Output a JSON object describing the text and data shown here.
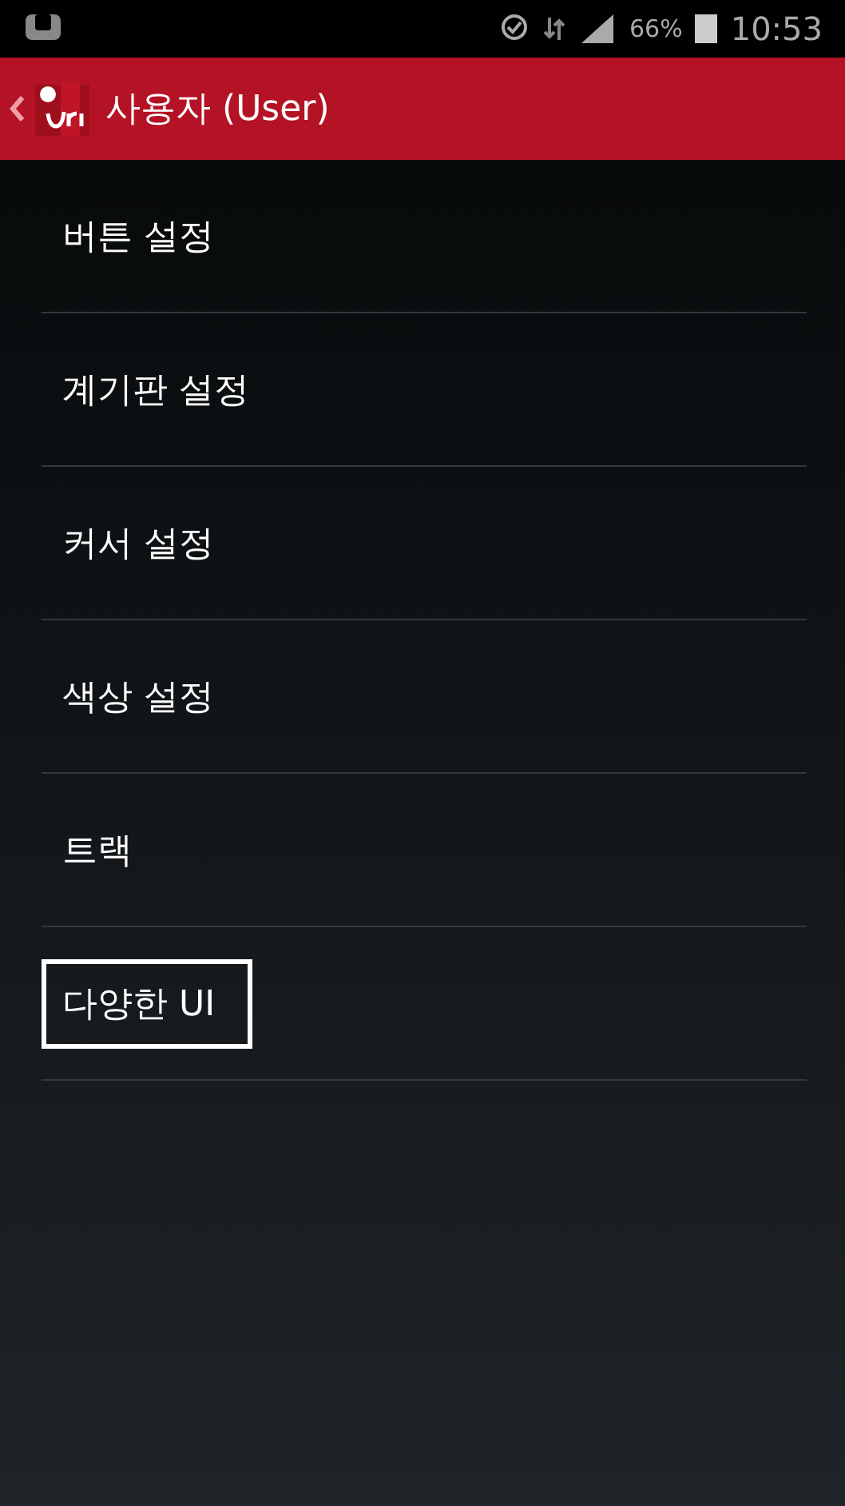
{
  "status_bar": {
    "battery": "66%",
    "time": "10:53"
  },
  "app_bar": {
    "title": "사용자 (User)"
  },
  "items": [
    {
      "label": "버튼 설정",
      "selected": false
    },
    {
      "label": "계기판 설정",
      "selected": false
    },
    {
      "label": "커서 설정",
      "selected": false
    },
    {
      "label": "색상 설정",
      "selected": false
    },
    {
      "label": "트랙",
      "selected": false
    },
    {
      "label": "다양한 UI",
      "selected": true
    }
  ]
}
